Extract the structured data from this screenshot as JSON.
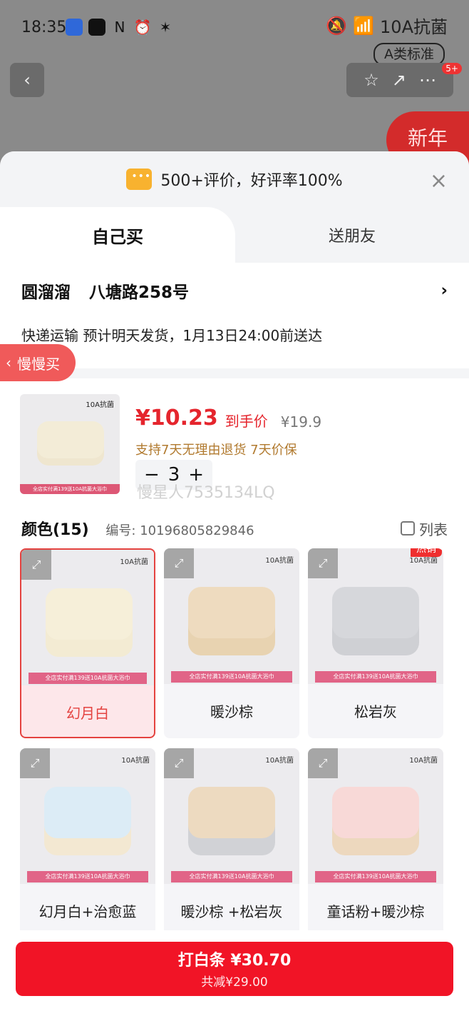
{
  "status_bar": {
    "time": "18:35",
    "network_label": "10A抗菌",
    "standard_badge": "A类标准",
    "notification_count": "5+"
  },
  "promo": {
    "new_year": "新年"
  },
  "sheet": {
    "rating_text": "500+评价，好评率100%",
    "tabs": [
      {
        "label": "自己买"
      },
      {
        "label": "送朋友"
      }
    ],
    "address": {
      "name": "圆溜溜",
      "street": "八塘路258号"
    },
    "shipping_text": "快递运输 预计明天发货，1月13日24:00前送达",
    "slow_buy_label": "慢慢买",
    "price": {
      "current": "¥10.23",
      "label": "到手价",
      "original": "¥19.9"
    },
    "return_policy": "支持7天无理由退货 7天价保",
    "quantity": "3",
    "watermark": "慢星人7535134LQ",
    "color_section": {
      "title": "颜色(15)",
      "code": "编号: 10196805829846",
      "list_label": "列表"
    },
    "colors": [
      {
        "name": "幻月白",
        "selected": true,
        "hot": false,
        "front": "#f6efd9",
        "back": "#f3ebd3"
      },
      {
        "name": "暖沙棕",
        "selected": false,
        "hot": false,
        "front": "#eedbbf",
        "back": "#e8d3b1"
      },
      {
        "name": "松岩灰",
        "selected": false,
        "hot": true,
        "front": "#d6d7db",
        "back": "#cfd0d4"
      },
      {
        "name": "幻月白+治愈蓝",
        "selected": false,
        "hot": false,
        "front": "#dcecf6",
        "back": "#f3e8d2"
      },
      {
        "name": "暖沙棕 +松岩灰",
        "selected": false,
        "hot": false,
        "front": "#eddac0",
        "back": "#d1d2d6"
      },
      {
        "name": "童话粉+暖沙棕",
        "selected": false,
        "hot": false,
        "front": "#f8d9d7",
        "back": "#edd8be"
      }
    ],
    "hot_badge": "热销",
    "thumb_banner": "全店实付满139送10A抗菌大浴巾（80*150cm）",
    "thumb_tag": "10A抗菌"
  },
  "bottom": {
    "buy_label": "打白条 ¥30.70",
    "saving_label": "共减¥29.00"
  },
  "colors": {
    "accent": "#f11426",
    "price": "#e5252d",
    "return_note": "#b17a2f"
  }
}
